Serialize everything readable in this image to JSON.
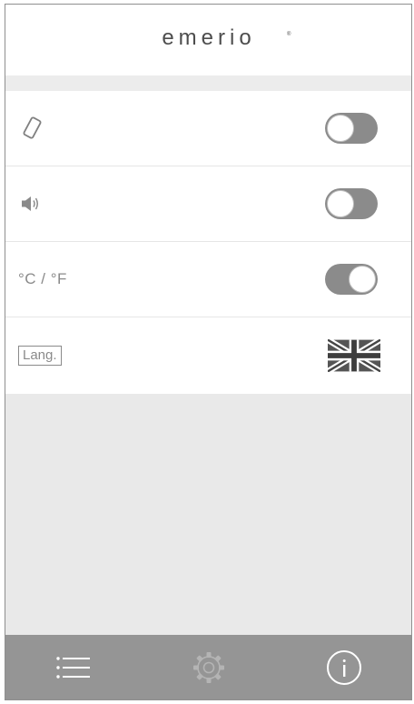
{
  "header": {
    "logo_text": "emerio"
  },
  "settings": {
    "rows": [
      {
        "icon": "vibration-icon",
        "control": "toggle",
        "state": "off"
      },
      {
        "icon": "speaker-icon",
        "control": "toggle",
        "state": "off"
      },
      {
        "label": "°C / °F",
        "control": "toggle",
        "state": "on"
      },
      {
        "label": "Lang.",
        "control": "flag",
        "flag_icon": "uk-flag-icon"
      }
    ]
  },
  "tabbar": {
    "items": [
      {
        "icon": "list-icon"
      },
      {
        "icon": "gear-icon"
      },
      {
        "icon": "info-icon"
      }
    ]
  },
  "colors": {
    "toggle_track": "#8b8b8b",
    "tabbar": "#959595",
    "background": "#e9e9e9"
  }
}
